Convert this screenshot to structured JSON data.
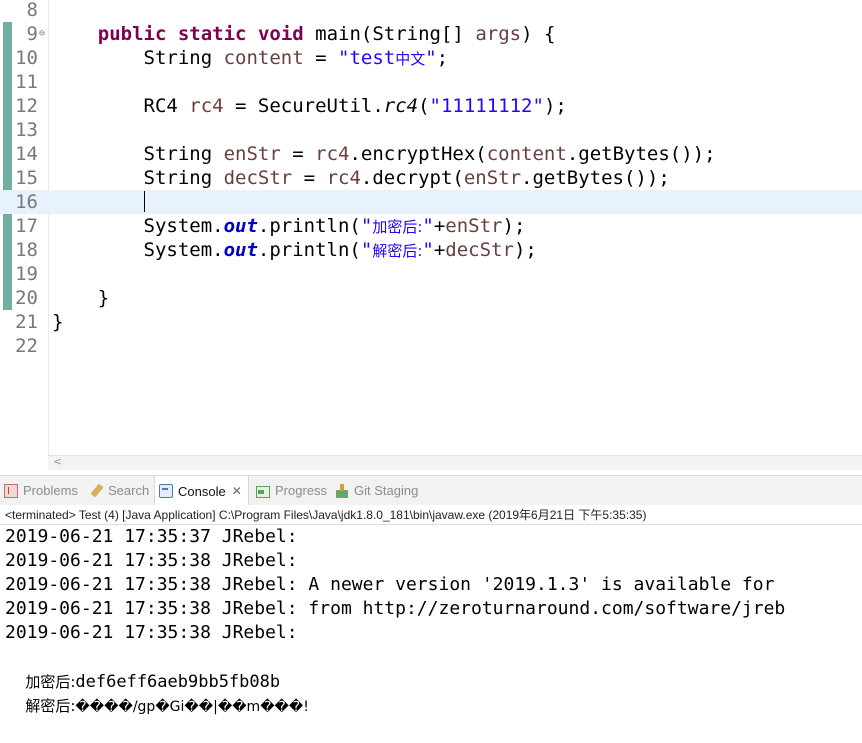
{
  "editor": {
    "lines": [
      {
        "num": "8",
        "segments": []
      },
      {
        "num": "9",
        "fold": "⊖",
        "segments": [
          {
            "t": "    "
          },
          {
            "t": "public",
            "c": "kw"
          },
          {
            "t": " "
          },
          {
            "t": "static",
            "c": "kw"
          },
          {
            "t": " "
          },
          {
            "t": "void",
            "c": "kw"
          },
          {
            "t": " main(String[] "
          },
          {
            "t": "args",
            "c": "var"
          },
          {
            "t": ") {"
          }
        ]
      },
      {
        "num": "10",
        "segments": [
          {
            "t": "        String "
          },
          {
            "t": "content",
            "c": "var"
          },
          {
            "t": " = "
          },
          {
            "t": "\"test",
            "c": "str"
          },
          {
            "t": "中文",
            "c": "str cjk"
          },
          {
            "t": "\"",
            "c": "str"
          },
          {
            "t": ";"
          }
        ]
      },
      {
        "num": "11",
        "segments": []
      },
      {
        "num": "12",
        "segments": [
          {
            "t": "        RC4 "
          },
          {
            "t": "rc4",
            "c": "var"
          },
          {
            "t": " = SecureUtil."
          },
          {
            "t": "rc4",
            "c": "it"
          },
          {
            "t": "("
          },
          {
            "t": "\"11111112\"",
            "c": "str"
          },
          {
            "t": ");"
          }
        ]
      },
      {
        "num": "13",
        "segments": []
      },
      {
        "num": "14",
        "segments": [
          {
            "t": "        String "
          },
          {
            "t": "enStr",
            "c": "var"
          },
          {
            "t": " = "
          },
          {
            "t": "rc4",
            "c": "var"
          },
          {
            "t": ".encryptHex("
          },
          {
            "t": "content",
            "c": "var"
          },
          {
            "t": ".getBytes());"
          }
        ]
      },
      {
        "num": "15",
        "segments": [
          {
            "t": "        String "
          },
          {
            "t": "decStr",
            "c": "var"
          },
          {
            "t": " = "
          },
          {
            "t": "rc4",
            "c": "var"
          },
          {
            "t": ".decrypt("
          },
          {
            "t": "enStr",
            "c": "var"
          },
          {
            "t": ".getBytes());"
          }
        ]
      },
      {
        "num": "16",
        "current": true,
        "caret": true,
        "segments": [
          {
            "t": "        "
          }
        ]
      },
      {
        "num": "17",
        "segments": [
          {
            "t": "        System."
          },
          {
            "t": "out",
            "c": "fld"
          },
          {
            "t": ".println("
          },
          {
            "t": "\"",
            "c": "str"
          },
          {
            "t": "加密后:",
            "c": "str cjk"
          },
          {
            "t": "\"",
            "c": "str"
          },
          {
            "t": "+"
          },
          {
            "t": "enStr",
            "c": "var"
          },
          {
            "t": ");"
          }
        ]
      },
      {
        "num": "18",
        "segments": [
          {
            "t": "        System."
          },
          {
            "t": "out",
            "c": "fld"
          },
          {
            "t": ".println("
          },
          {
            "t": "\"",
            "c": "str"
          },
          {
            "t": "解密后:",
            "c": "str cjk"
          },
          {
            "t": "\"",
            "c": "str"
          },
          {
            "t": "+"
          },
          {
            "t": "decStr",
            "c": "var"
          },
          {
            "t": ");"
          }
        ]
      },
      {
        "num": "19",
        "segments": []
      },
      {
        "num": "20",
        "segments": [
          {
            "t": "    }"
          }
        ]
      },
      {
        "num": "21",
        "segments": [
          {
            "t": "}"
          }
        ]
      },
      {
        "num": "22",
        "segments": []
      }
    ]
  },
  "tabs": {
    "problems": "Problems",
    "search": "Search",
    "console": "Console",
    "console_close": "✕",
    "progress": "Progress",
    "git_staging": "Git Staging"
  },
  "console": {
    "header": "<terminated> Test (4) [Java Application] C:\\Program Files\\Java\\jdk1.8.0_181\\bin\\javaw.exe (2019年6月21日 下午5:35:35)",
    "log_lines": [
      "2019-06-21 17:35:37 JRebel:",
      "2019-06-21 17:35:38 JRebel:",
      "2019-06-21 17:35:38 JRebel: A newer version '2019.1.3' is available for",
      "2019-06-21 17:35:38 JRebel: from http://zeroturnaround.com/software/jreb",
      "2019-06-21 17:35:38 JRebel:"
    ],
    "encrypted_label": "加密后:",
    "encrypted_value": "def6eff6aeb9bb5fb08b",
    "decrypted_label": "解密后:",
    "decrypted_value": "����/gp�Gi��|��m���!"
  },
  "colors": {
    "keyword": "#7f0055",
    "variable": "#6a3e3e",
    "string": "#2a00ff",
    "field": "#0000c0",
    "current_line": "#e8f2fe",
    "change_bar": "#6fb0a2"
  }
}
